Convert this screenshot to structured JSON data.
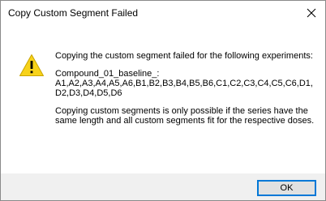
{
  "window": {
    "title": "Copy Custom Segment Failed",
    "close_icon": "close-icon"
  },
  "message": {
    "icon": "warning-icon",
    "intro": "Copying the custom segment failed for the following experiments:",
    "compound": "Compound_01_baseline_:",
    "experiments": "A1,A2,A3,A4,A5,A6,B1,B2,B3,B4,B5,B6,C1,C2,C3,C4,C5,C6,D1,D2,D3,D4,D5,D6",
    "note": "Copying custom segments is only possible if the series have the same length and all custom segments fit for the respective doses."
  },
  "footer": {
    "ok_label": "OK"
  },
  "colors": {
    "warning_fill": "#f7d21a",
    "accent_border": "#0078d7",
    "footer_bg": "#f0f0f0"
  }
}
